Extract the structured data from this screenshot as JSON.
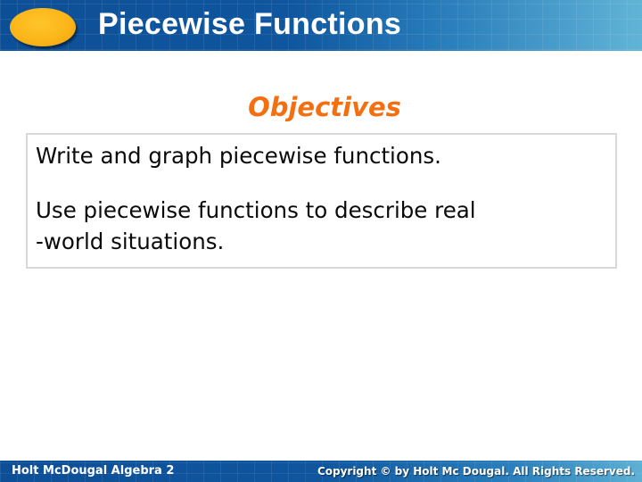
{
  "header": {
    "title": "Piecewise Functions",
    "logo_icon": "orange-oval-logo-icon",
    "colors": {
      "bar": "#0f569e",
      "logo": "#fbb417"
    }
  },
  "section": {
    "heading": "Objectives",
    "heading_color": "#f36f10"
  },
  "objectives": [
    {
      "text": "Write and graph piecewise functions."
    },
    {
      "text": "Use piecewise functions to describe real\n-world situations.",
      "lines": [
        "Use piecewise functions to describe real",
        "-world situations."
      ]
    }
  ],
  "footer": {
    "book": "Holt McDougal Algebra 2",
    "copyright": "Copyright © by Holt Mc Dougal. All Rights Reserved."
  }
}
